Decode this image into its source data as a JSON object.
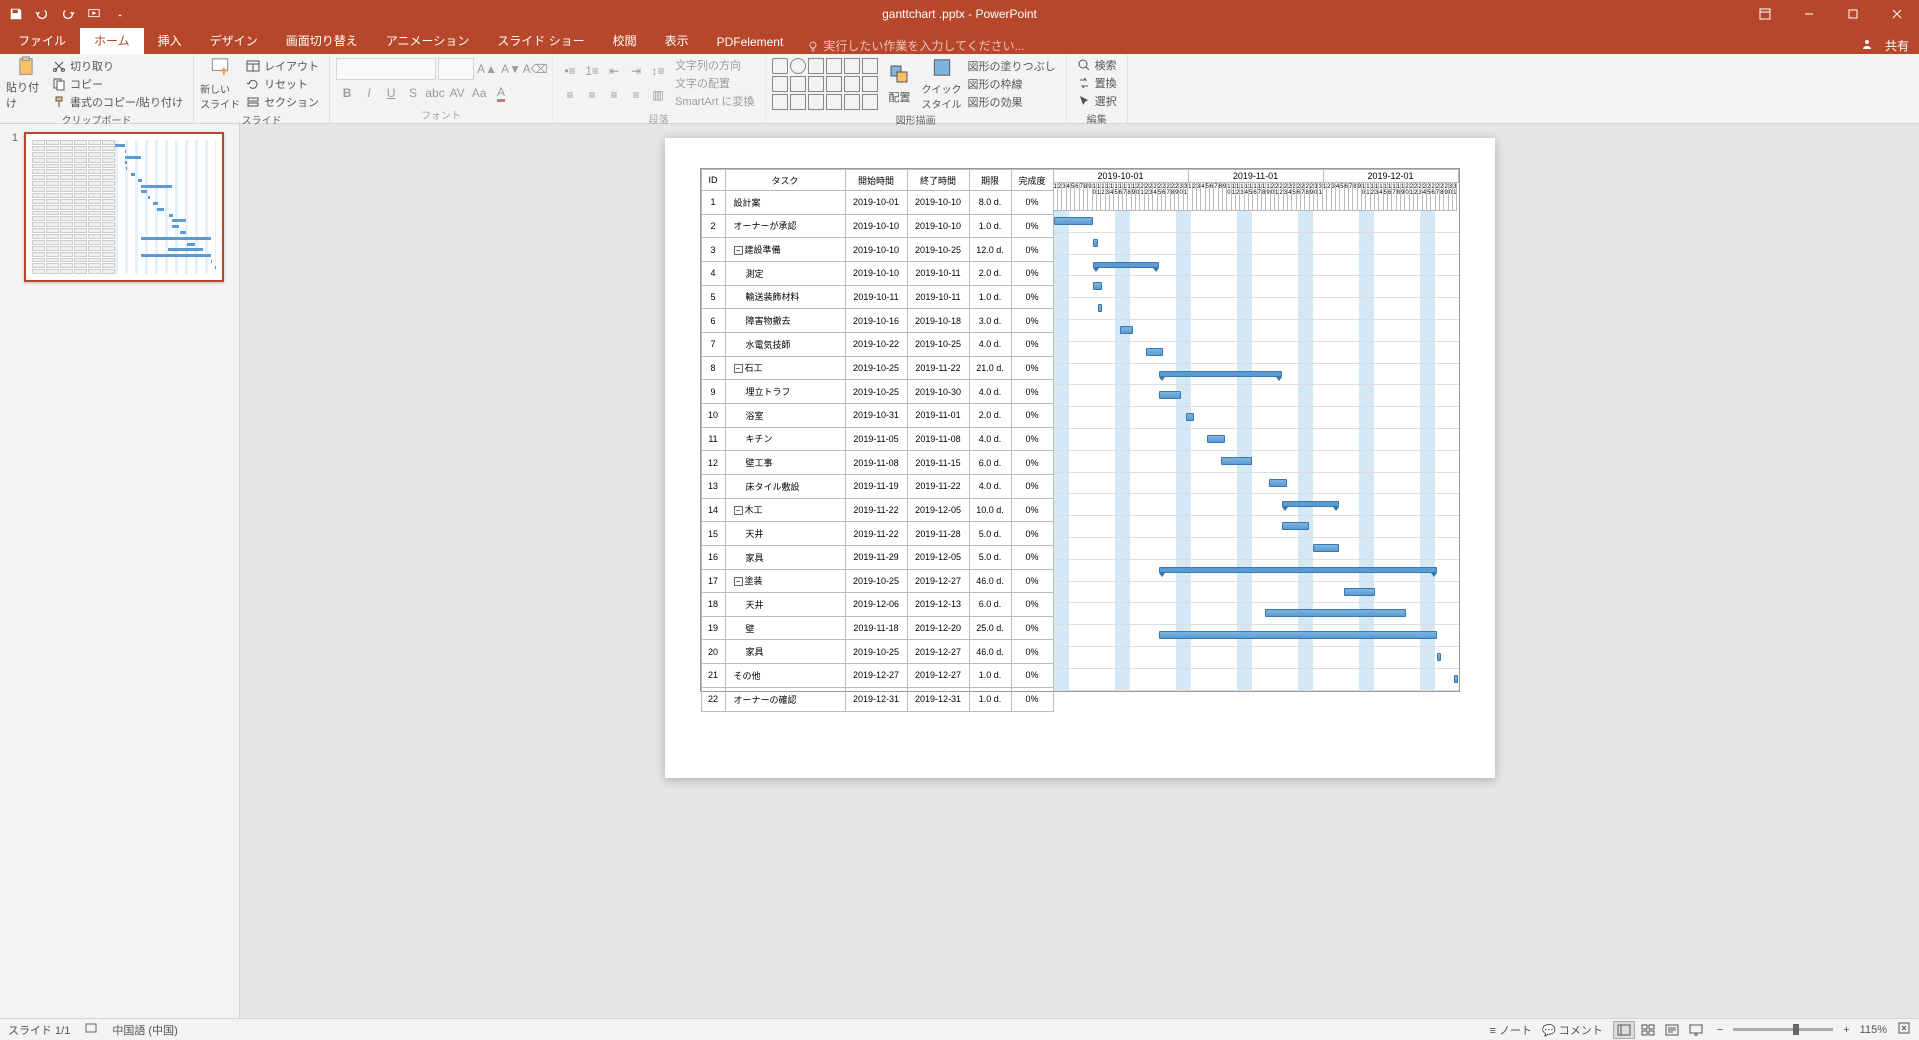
{
  "title_bar": {
    "title": "ganttchart .pptx - PowerPoint",
    "ribbon_display": "リボン表示"
  },
  "ribbon_tabs": {
    "file": "ファイル",
    "home": "ホーム",
    "insert": "挿入",
    "design": "デザイン",
    "transitions": "画面切り替え",
    "animations": "アニメーション",
    "slideshow": "スライド ショー",
    "review": "校閲",
    "view": "表示",
    "pdfelement": "PDFelement",
    "tell_me": "実行したい作業を入力してください...",
    "sign_in": "サインイン",
    "share": "共有"
  },
  "ribbon": {
    "clipboard": {
      "label": "クリップボード",
      "paste": "貼り付け",
      "cut": "切り取り",
      "copy": "コピー",
      "format_painter": "書式のコピー/貼り付け"
    },
    "slides": {
      "label": "スライド",
      "new_slide": "新しい\nスライド",
      "layout": "レイアウト",
      "reset": "リセット",
      "section": "セクション"
    },
    "font": {
      "label": "フォント"
    },
    "paragraph": {
      "label": "段落",
      "text_direction": "文字列の方向",
      "align_text": "文字の配置",
      "smartart": "SmartArt に変換"
    },
    "drawing": {
      "label": "図形描画",
      "arrange": "配置",
      "quick_styles": "クイック\nスタイル",
      "shape_fill": "図形の塗りつぶし",
      "shape_outline": "図形の枠線",
      "shape_effects": "図形の効果"
    },
    "editing": {
      "label": "編集",
      "find": "検索",
      "replace": "置換",
      "select": "選択"
    }
  },
  "thumbnail": {
    "num": "1"
  },
  "gantt_headers": {
    "id": "ID",
    "task": "タスク",
    "start": "開始時間",
    "end": "終了時間",
    "duration": "期限",
    "complete": "完成度",
    "months": [
      "2019-10-01",
      "2019-11-01",
      "2019-12-01"
    ],
    "day_digits": "1234567890111111111122222222223\n          0123456789012345678901"
  },
  "chart_data": {
    "type": "gantt",
    "timeline_start": "2019-10-01",
    "timeline_end": "2019-12-31",
    "rows": [
      {
        "id": "1",
        "task": "設計案",
        "start": "2019-10-01",
        "end": "2019-10-10",
        "duration": "8.0 d.",
        "complete": "0%",
        "indent": 0,
        "summary": false,
        "bar_left_pct": 0.0,
        "bar_width_pct": 9.8
      },
      {
        "id": "2",
        "task": "オーナーが承認",
        "start": "2019-10-10",
        "end": "2019-10-10",
        "duration": "1.0 d.",
        "complete": "0%",
        "indent": 0,
        "summary": false,
        "bar_left_pct": 9.8,
        "bar_width_pct": 1.1
      },
      {
        "id": "3",
        "task": "建設準備",
        "start": "2019-10-10",
        "end": "2019-10-25",
        "duration": "12.0 d.",
        "complete": "0%",
        "indent": 0,
        "summary": true,
        "bar_left_pct": 9.8,
        "bar_width_pct": 16.3
      },
      {
        "id": "4",
        "task": "測定",
        "start": "2019-10-10",
        "end": "2019-10-11",
        "duration": "2.0 d.",
        "complete": "0%",
        "indent": 1,
        "summary": false,
        "bar_left_pct": 9.8,
        "bar_width_pct": 2.2
      },
      {
        "id": "5",
        "task": "輸送装飾材料",
        "start": "2019-10-11",
        "end": "2019-10-11",
        "duration": "1.0 d.",
        "complete": "0%",
        "indent": 1,
        "summary": false,
        "bar_left_pct": 10.9,
        "bar_width_pct": 1.1
      },
      {
        "id": "6",
        "task": "障害物撤去",
        "start": "2019-10-16",
        "end": "2019-10-18",
        "duration": "3.0 d.",
        "complete": "0%",
        "indent": 1,
        "summary": false,
        "bar_left_pct": 16.3,
        "bar_width_pct": 3.3
      },
      {
        "id": "7",
        "task": "水電気技師",
        "start": "2019-10-22",
        "end": "2019-10-25",
        "duration": "4.0 d.",
        "complete": "0%",
        "indent": 1,
        "summary": false,
        "bar_left_pct": 22.8,
        "bar_width_pct": 4.3
      },
      {
        "id": "8",
        "task": "石工",
        "start": "2019-10-25",
        "end": "2019-11-22",
        "duration": "21.0 d.",
        "complete": "0%",
        "indent": 0,
        "summary": true,
        "bar_left_pct": 26.1,
        "bar_width_pct": 30.4
      },
      {
        "id": "9",
        "task": "埋立トラフ",
        "start": "2019-10-25",
        "end": "2019-10-30",
        "duration": "4.0 d.",
        "complete": "0%",
        "indent": 1,
        "summary": false,
        "bar_left_pct": 26.1,
        "bar_width_pct": 5.4
      },
      {
        "id": "10",
        "task": "浴室",
        "start": "2019-10-31",
        "end": "2019-11-01",
        "duration": "2.0 d.",
        "complete": "0%",
        "indent": 1,
        "summary": false,
        "bar_left_pct": 32.6,
        "bar_width_pct": 2.2
      },
      {
        "id": "11",
        "task": "キチン",
        "start": "2019-11-05",
        "end": "2019-11-08",
        "duration": "4.0 d.",
        "complete": "0%",
        "indent": 1,
        "summary": false,
        "bar_left_pct": 38.0,
        "bar_width_pct": 4.3
      },
      {
        "id": "12",
        "task": "壁工事",
        "start": "2019-11-08",
        "end": "2019-11-15",
        "duration": "6.0 d.",
        "complete": "0%",
        "indent": 1,
        "summary": false,
        "bar_left_pct": 41.3,
        "bar_width_pct": 7.6
      },
      {
        "id": "13",
        "task": "床タイル敷設",
        "start": "2019-11-19",
        "end": "2019-11-22",
        "duration": "4.0 d.",
        "complete": "0%",
        "indent": 1,
        "summary": false,
        "bar_left_pct": 53.3,
        "bar_width_pct": 4.3
      },
      {
        "id": "14",
        "task": "木工",
        "start": "2019-11-22",
        "end": "2019-12-05",
        "duration": "10.0 d.",
        "complete": "0%",
        "indent": 0,
        "summary": true,
        "bar_left_pct": 56.5,
        "bar_width_pct": 14.1
      },
      {
        "id": "15",
        "task": "天井",
        "start": "2019-11-22",
        "end": "2019-11-28",
        "duration": "5.0 d.",
        "complete": "0%",
        "indent": 1,
        "summary": false,
        "bar_left_pct": 56.5,
        "bar_width_pct": 6.5
      },
      {
        "id": "16",
        "task": "家具",
        "start": "2019-11-29",
        "end": "2019-12-05",
        "duration": "5.0 d.",
        "complete": "0%",
        "indent": 1,
        "summary": false,
        "bar_left_pct": 64.1,
        "bar_width_pct": 6.5
      },
      {
        "id": "17",
        "task": "塗装",
        "start": "2019-10-25",
        "end": "2019-12-27",
        "duration": "46.0 d.",
        "complete": "0%",
        "indent": 0,
        "summary": true,
        "bar_left_pct": 26.1,
        "bar_width_pct": 68.5
      },
      {
        "id": "18",
        "task": "天井",
        "start": "2019-12-06",
        "end": "2019-12-13",
        "duration": "6.0 d.",
        "complete": "0%",
        "indent": 1,
        "summary": false,
        "bar_left_pct": 71.7,
        "bar_width_pct": 7.6
      },
      {
        "id": "19",
        "task": "壁",
        "start": "2019-11-18",
        "end": "2019-12-20",
        "duration": "25.0 d.",
        "complete": "0%",
        "indent": 1,
        "summary": false,
        "bar_left_pct": 52.2,
        "bar_width_pct": 34.8
      },
      {
        "id": "20",
        "task": "家具",
        "start": "2019-10-25",
        "end": "2019-12-27",
        "duration": "46.0 d.",
        "complete": "0%",
        "indent": 1,
        "summary": false,
        "bar_left_pct": 26.1,
        "bar_width_pct": 68.5
      },
      {
        "id": "21",
        "task": "その他",
        "start": "2019-12-27",
        "end": "2019-12-27",
        "duration": "1.0 d.",
        "complete": "0%",
        "indent": 0,
        "summary": false,
        "bar_left_pct": 94.6,
        "bar_width_pct": 1.1
      },
      {
        "id": "22",
        "task": "オーナーの確認",
        "start": "2019-12-31",
        "end": "2019-12-31",
        "duration": "1.0 d.",
        "complete": "0%",
        "indent": 0,
        "summary": false,
        "bar_left_pct": 98.9,
        "bar_width_pct": 1.1
      }
    ]
  },
  "status_bar": {
    "slide_info": "スライド 1/1",
    "language": "中国語 (中国)",
    "notes": "ノート",
    "comments": "コメント",
    "zoom": "115%"
  }
}
